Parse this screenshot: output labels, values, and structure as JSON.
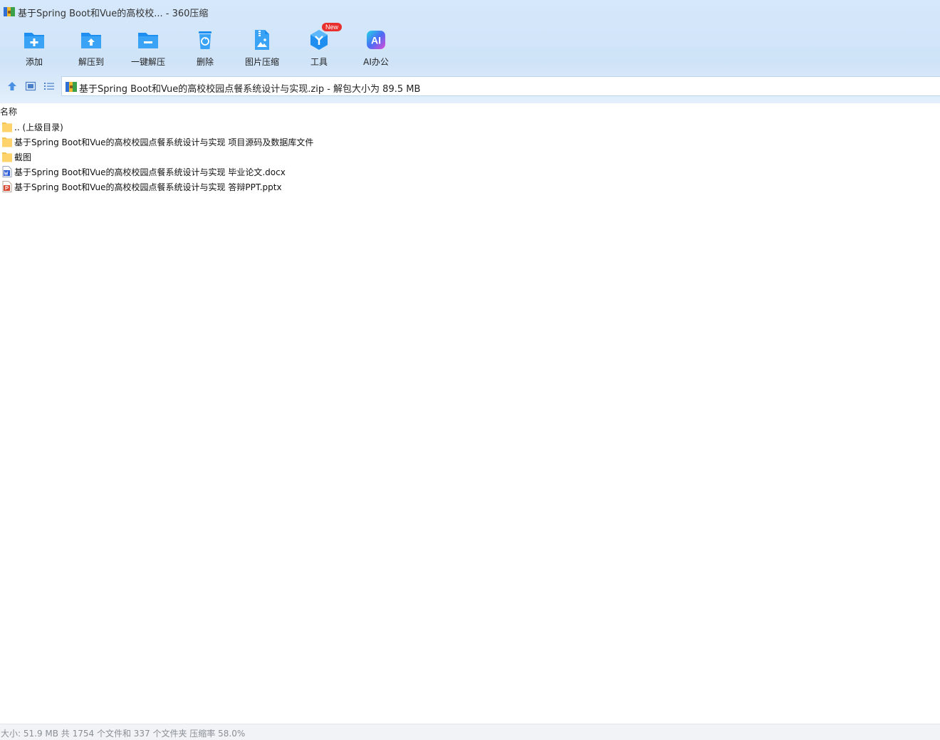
{
  "window": {
    "title": "基于Spring Boot和Vue的高校校... - 360压缩",
    "icon": "archive-icon"
  },
  "toolbar": {
    "items": [
      {
        "label": "添加",
        "icon": "add-folder-icon"
      },
      {
        "label": "解压到",
        "icon": "extract-to-icon"
      },
      {
        "label": "一键解压",
        "icon": "one-click-extract-icon"
      },
      {
        "label": "删除",
        "icon": "recycle-bin-icon"
      },
      {
        "label": "图片压缩",
        "icon": "image-compress-icon"
      },
      {
        "label": "工具",
        "icon": "tools-icon",
        "badge": "New"
      },
      {
        "label": "AI办公",
        "icon": "ai-icon",
        "icon_text": "AI"
      }
    ]
  },
  "nav": {
    "address": "基于Spring Boot和Vue的高校校园点餐系统设计与实现.zip",
    "separator": " - ",
    "unpacked_size": "解包大小为 89.5 MB"
  },
  "list": {
    "column_name": "名称",
    "rows": [
      {
        "name": ".. (上级目录)",
        "type": "folder"
      },
      {
        "name": "基于Spring Boot和Vue的高校校园点餐系统设计与实现 项目源码及数据库文件",
        "type": "folder"
      },
      {
        "name": "截图",
        "type": "folder"
      },
      {
        "name": "基于Spring Boot和Vue的高校校园点餐系统设计与实现 毕业论文.docx",
        "type": "docx"
      },
      {
        "name": "基于Spring Boot和Vue的高校校园点餐系统设计与实现 答辩PPT.pptx",
        "type": "pptx"
      }
    ]
  },
  "status": {
    "text": "大小: 51.9 MB 共 1754 个文件和 337 个文件夹 压缩率 58.0%"
  },
  "colors": {
    "accent_blue": "#1e8ff0",
    "folder_yellow": "#ffd36b",
    "word_blue": "#2b5cd6",
    "ppt_red": "#d9472f",
    "badge_red": "#e8312f"
  }
}
